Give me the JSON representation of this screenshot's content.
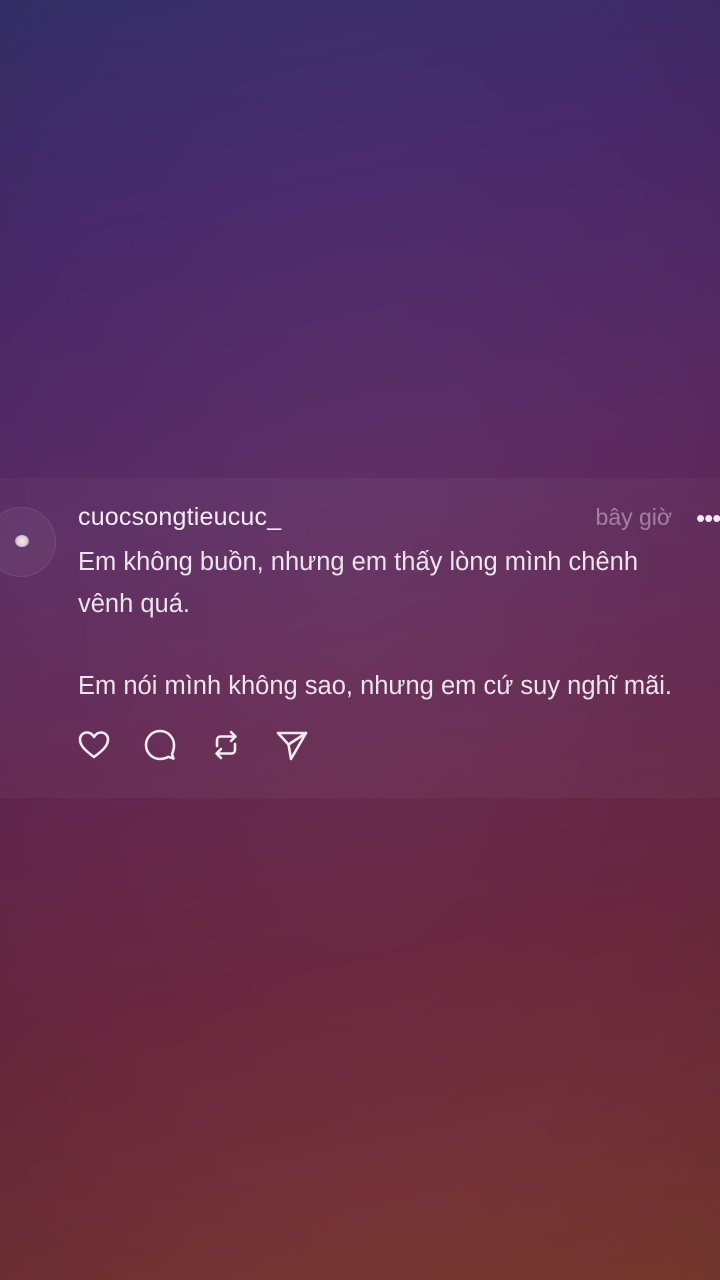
{
  "post": {
    "username": "cuocsongtieucuc_",
    "timestamp": "bây giờ",
    "more_label": "•••",
    "text_line_1": "Em không buồn, nhưng em thấy lòng mình chênh",
    "text_line_2": "vênh quá.",
    "text_line_3": "Em nói mình không sao, nhưng em cứ suy nghĩ mãi."
  },
  "actions": {
    "like_icon": "heart-icon",
    "reply_icon": "comment-icon",
    "repost_icon": "repost-icon",
    "share_icon": "send-icon"
  },
  "colors": {
    "background_top": "#35306a",
    "background_bottom": "#7a3a2e",
    "text": "#ece4ec"
  }
}
